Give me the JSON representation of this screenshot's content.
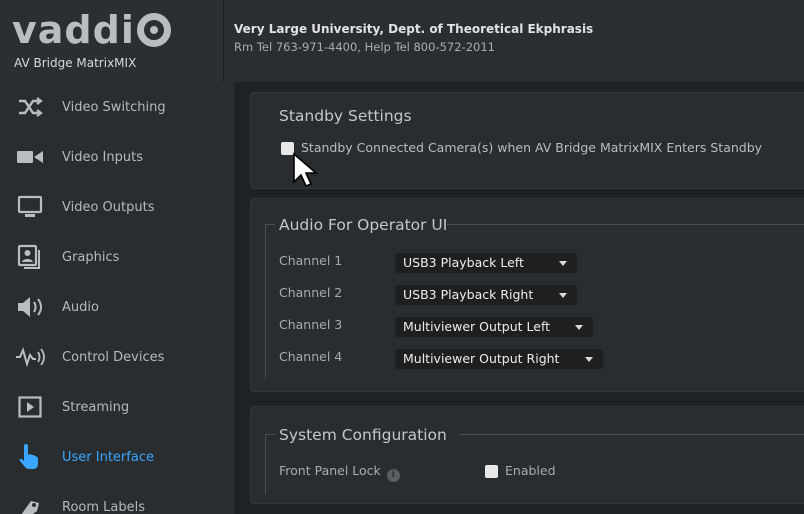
{
  "brand": {
    "logo_text": "vaddi",
    "product": "AV Bridge MatrixMIX"
  },
  "header": {
    "line1": "Very Large University, Dept. of Theoretical Ekphrasis",
    "line2": "Rm Tel 763-971-4400, Help Tel 800-572-2011"
  },
  "sidebar": {
    "items": [
      {
        "label": "Video Switching",
        "icon": "shuffle-icon"
      },
      {
        "label": "Video Inputs",
        "icon": "camera-icon"
      },
      {
        "label": "Video Outputs",
        "icon": "monitor-icon"
      },
      {
        "label": "Graphics",
        "icon": "graphics-icon"
      },
      {
        "label": "Audio",
        "icon": "speaker-icon"
      },
      {
        "label": "Control Devices",
        "icon": "control-devices-icon"
      },
      {
        "label": "Streaming",
        "icon": "play-icon"
      },
      {
        "label": "User Interface",
        "icon": "pointing-hand-icon",
        "active": true
      },
      {
        "label": "Room Labels",
        "icon": "label-icon"
      }
    ]
  },
  "standby": {
    "title": "Standby Settings",
    "checkbox_label": "Standby Connected Camera(s) when AV Bridge MatrixMIX Enters Standby",
    "checked": false
  },
  "audio_ui": {
    "title": "Audio For Operator UI",
    "channels": [
      {
        "label": "Channel 1",
        "value": "USB3 Playback Left"
      },
      {
        "label": "Channel 2",
        "value": "USB3 Playback Right"
      },
      {
        "label": "Channel 3",
        "value": "Multiviewer Output Left"
      },
      {
        "label": "Channel 4",
        "value": "Multiviewer Output Right"
      }
    ]
  },
  "system": {
    "title": "System Configuration",
    "front_panel_label": "Front Panel Lock",
    "enabled_label": "Enabled",
    "enabled": false
  },
  "colors": {
    "accent": "#3aa6ff",
    "background": "#1f2224",
    "panel": "#2a2d30"
  }
}
